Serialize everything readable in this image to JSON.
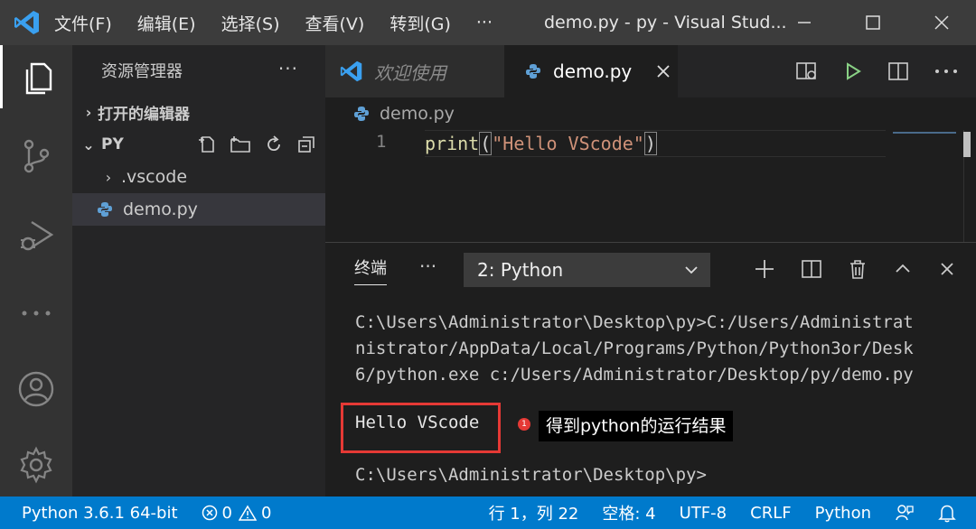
{
  "titlebar": {
    "menu": [
      "文件(F)",
      "编辑(E)",
      "选择(S)",
      "查看(V)",
      "转到(G)",
      "···"
    ],
    "title": "demo.py - py - Visual Stud..."
  },
  "sidebar": {
    "header": "资源管理器",
    "more": "···",
    "open_editors": "打开的编辑器",
    "folder": "PY",
    "items": [
      {
        "label": ".vscode"
      },
      {
        "label": "demo.py"
      }
    ]
  },
  "tabs": {
    "welcome": "欢迎使用",
    "active": "demo.py"
  },
  "editor": {
    "breadcrumb": "demo.py",
    "line_number": "1",
    "code_fn": "print",
    "code_open": "(",
    "code_str": "\"Hello VScode\"",
    "code_close": ")"
  },
  "panel": {
    "tab": "终端",
    "more": "···",
    "terminal_select": "2: Python",
    "lines": [
      "C:\\Users\\Administrator\\Desktop\\py>C:/Users/Administrat",
      "nistrator/AppData/Local/Programs/Python/Python3or/Desk",
      "6/python.exe c:/Users/Administrator/Desktop/py/demo.py"
    ],
    "output": "Hello VScode",
    "annotation_num": "1",
    "annotation": "得到python的运行结果",
    "prompt": "C:\\Users\\Administrator\\Desktop\\py>"
  },
  "statusbar": {
    "interpreter": "Python 3.6.1 64-bit",
    "errors": "0",
    "warnings": "0",
    "position": "行 1，列 22",
    "indent": "空格: 4",
    "encoding": "UTF-8",
    "eol": "CRLF",
    "language": "Python"
  },
  "colors": {
    "accent": "#007acc",
    "highlight": "#e53935"
  }
}
